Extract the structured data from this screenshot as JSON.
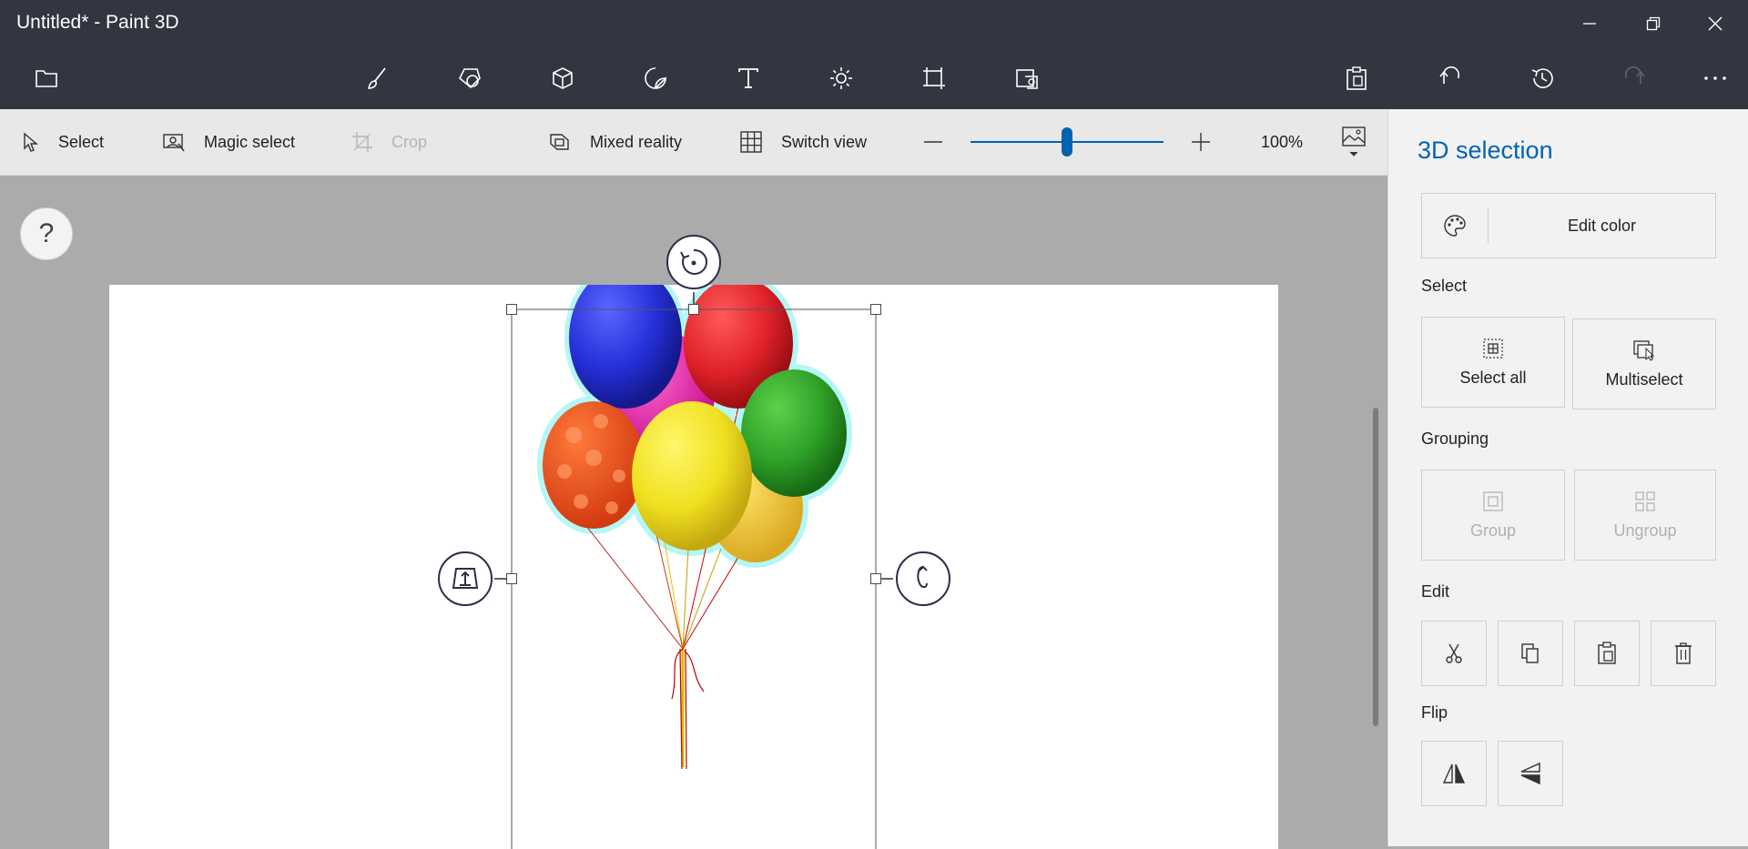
{
  "window": {
    "title": "Untitled* - Paint 3D"
  },
  "toolbar": {
    "icons": [
      "folder-icon",
      "brush-icon",
      "2d-shapes-icon",
      "3d-shapes-icon",
      "stickers-icon",
      "text-icon",
      "effects-icon",
      "canvas-icon",
      "3d-library-icon",
      "paste-icon",
      "undo-icon",
      "history-icon",
      "redo-icon",
      "more-icon"
    ]
  },
  "subbar": {
    "select": "Select",
    "magic_select": "Magic select",
    "crop": "Crop",
    "mixed_reality": "Mixed reality",
    "switch_view": "Switch view",
    "zoom_value": "100%",
    "zoom_slider_fraction": 0.5
  },
  "workspace": {
    "help": "?"
  },
  "panel": {
    "title": "3D selection",
    "edit_color": "Edit color",
    "select_heading": "Select",
    "select_all": "Select all",
    "multiselect": "Multiselect",
    "grouping_heading": "Grouping",
    "group": "Group",
    "ungroup": "Ungroup",
    "edit_heading": "Edit",
    "flip_heading": "Flip"
  },
  "colors": {
    "accent": "#0063b1",
    "titlebar": "#323641",
    "selection_glow": "#a9f5f5"
  }
}
